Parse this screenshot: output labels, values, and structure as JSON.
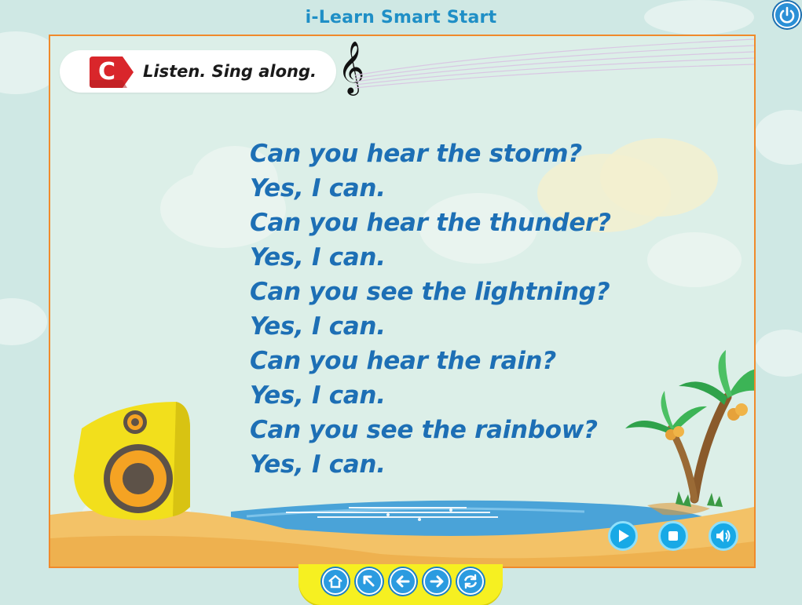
{
  "app": {
    "title": "i-Learn Smart Start"
  },
  "activity": {
    "section_letter": "C",
    "instruction": "Listen. Sing along."
  },
  "lyrics": [
    "Can you hear the storm?",
    "Yes, I can.",
    "Can you hear the thunder?",
    "Yes, I can.",
    "Can you see the lightning?",
    "Yes, I can.",
    "Can you hear the rain?",
    "Yes, I can.",
    "Can you see the rainbow?",
    "Yes, I can."
  ],
  "media_controls": [
    {
      "name": "play-button",
      "icon": "play-icon"
    },
    {
      "name": "stop-button",
      "icon": "stop-icon"
    },
    {
      "name": "volume-button",
      "icon": "speaker-icon"
    }
  ],
  "navigation": [
    {
      "name": "home-button",
      "icon": "home-icon"
    },
    {
      "name": "up-button",
      "icon": "arrow-up-left-icon"
    },
    {
      "name": "back-button",
      "icon": "arrow-left-icon"
    },
    {
      "name": "next-button",
      "icon": "arrow-right-icon"
    },
    {
      "name": "replay-button",
      "icon": "refresh-icon"
    }
  ],
  "colors": {
    "accent": "#1d6fb5",
    "frame_border": "#f08a2b",
    "badge": "#d9262b",
    "nav_bar": "#f6f021",
    "control": "#18a9e6"
  }
}
